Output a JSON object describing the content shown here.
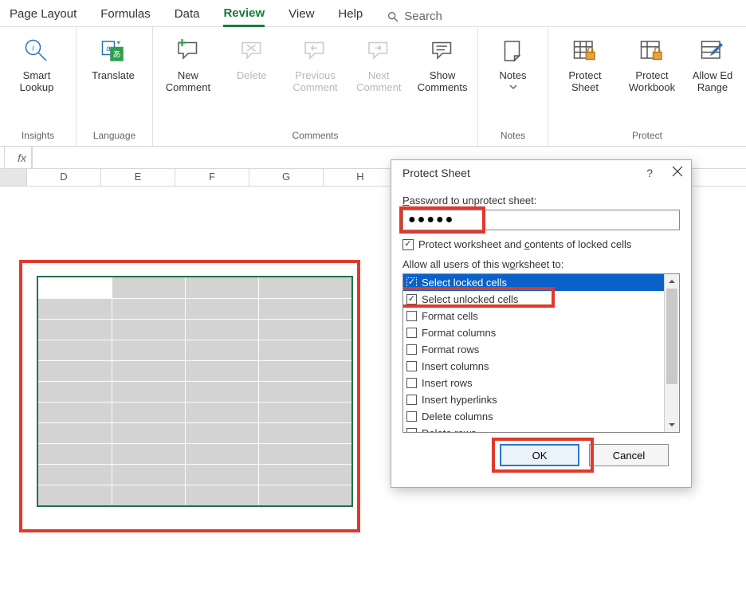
{
  "tabs": {
    "page_layout": "Page Layout",
    "formulas": "Formulas",
    "data": "Data",
    "review": "Review",
    "view": "View",
    "help": "Help",
    "search": "Search"
  },
  "ribbon": {
    "groups": {
      "insights": {
        "label": "Insights",
        "smart_lookup": "Smart Lookup"
      },
      "language": {
        "label": "Language",
        "translate": "Translate"
      },
      "comments": {
        "label": "Comments",
        "new_comment": "New Comment",
        "delete": "Delete",
        "previous": "Previous Comment",
        "next": "Next Comment",
        "show": "Show Comments"
      },
      "notes": {
        "label": "Notes",
        "notes": "Notes"
      },
      "protect": {
        "label": "Protect",
        "protect_sheet": "Protect Sheet",
        "protect_workbook": "Protect Workbook",
        "allow_edit_ranges_l1": "Allow Ed",
        "allow_edit_ranges_l2": "Range"
      }
    }
  },
  "fx": {
    "label": "fx"
  },
  "columns": [
    "D",
    "E",
    "F",
    "G",
    "H"
  ],
  "dialog": {
    "title": "Protect Sheet",
    "help": "?",
    "password_label_pre": "",
    "password_label": "Password to unprotect sheet:",
    "password_value": "●●●●●",
    "protect_chk_pre": "Protect worksheet and ",
    "protect_chk_u": "c",
    "protect_chk_post": "ontents of locked cells",
    "allow_label_pre": "Allow all users of this w",
    "allow_label_u": "o",
    "allow_label_post": "rksheet to:",
    "options": [
      {
        "label": "Select locked cells",
        "checked": true,
        "selected": true
      },
      {
        "label": "Select unlocked cells",
        "checked": true,
        "selected": false
      },
      {
        "label": "Format cells",
        "checked": false,
        "selected": false
      },
      {
        "label": "Format columns",
        "checked": false,
        "selected": false
      },
      {
        "label": "Format rows",
        "checked": false,
        "selected": false
      },
      {
        "label": "Insert columns",
        "checked": false,
        "selected": false
      },
      {
        "label": "Insert rows",
        "checked": false,
        "selected": false
      },
      {
        "label": "Insert hyperlinks",
        "checked": false,
        "selected": false
      },
      {
        "label": "Delete columns",
        "checked": false,
        "selected": false
      },
      {
        "label": "Delete rows",
        "checked": false,
        "selected": false
      }
    ],
    "ok": "OK",
    "cancel": "Cancel"
  }
}
